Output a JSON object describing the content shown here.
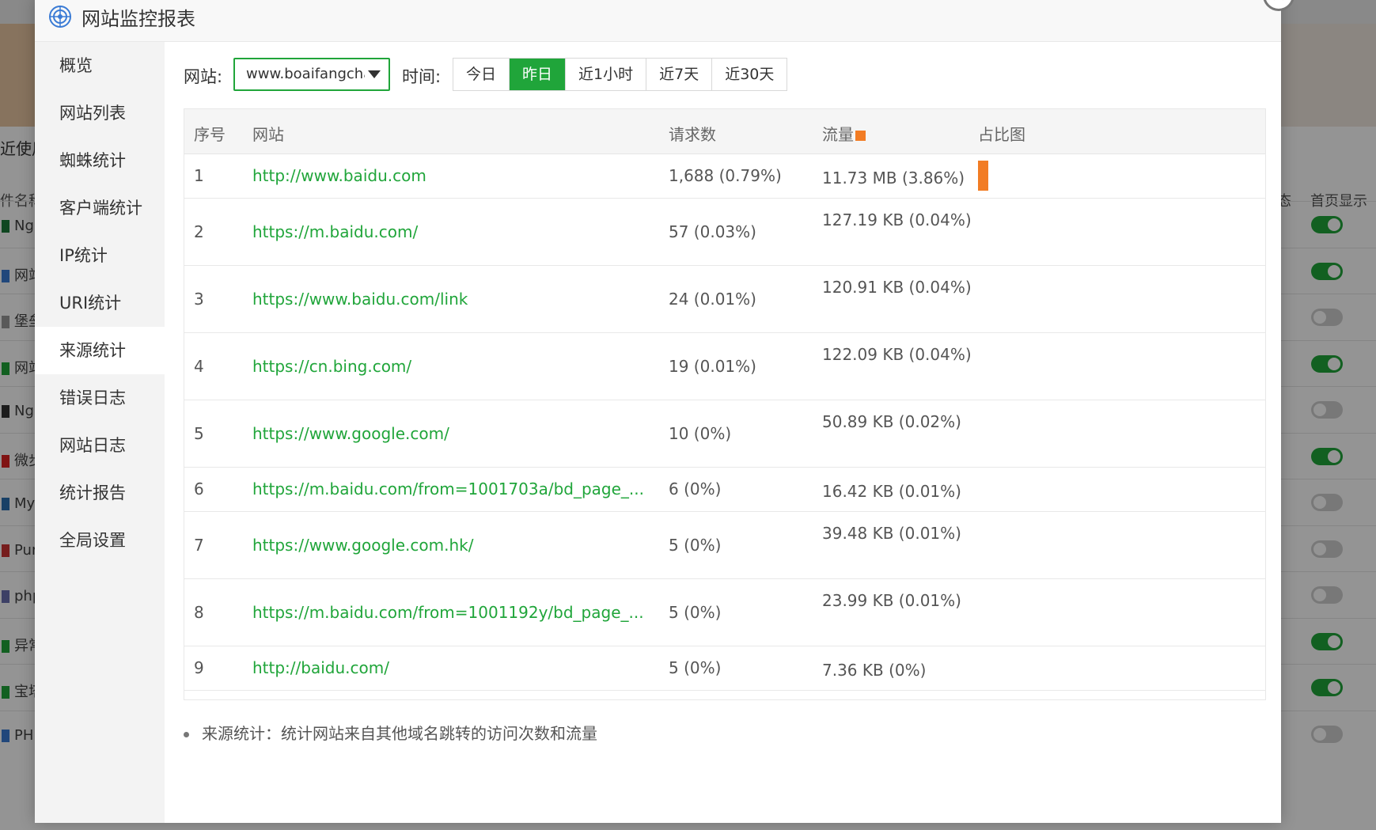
{
  "background": {
    "header_left": "近使用",
    "col_left": "件名称",
    "col_status": "态",
    "col_home": "首页显示",
    "rows": [
      {
        "label": "Ngi",
        "toggle": true
      },
      {
        "label": "网站",
        "toggle": true
      },
      {
        "label": "堡垒",
        "toggle": false
      },
      {
        "label": "网站",
        "toggle": true
      },
      {
        "label": "Ngi",
        "toggle": false
      },
      {
        "label": "微步",
        "toggle": true
      },
      {
        "label": "MyS",
        "toggle": false
      },
      {
        "label": "Pur",
        "toggle": false
      },
      {
        "label": "php",
        "toggle": false
      },
      {
        "label": "异常",
        "toggle": true
      },
      {
        "label": "宝塔",
        "toggle": true
      },
      {
        "label": "PHP",
        "toggle": false
      }
    ]
  },
  "modal": {
    "title": "网站监控报表",
    "close_icon": "close-icon"
  },
  "sidebar": {
    "items": [
      {
        "label": "概览",
        "active": false
      },
      {
        "label": "网站列表",
        "active": false
      },
      {
        "label": "蜘蛛统计",
        "active": false
      },
      {
        "label": "客户端统计",
        "active": false
      },
      {
        "label": "IP统计",
        "active": false
      },
      {
        "label": "URI统计",
        "active": false
      },
      {
        "label": "来源统计",
        "active": true
      },
      {
        "label": "错误日志",
        "active": false
      },
      {
        "label": "网站日志",
        "active": false
      },
      {
        "label": "统计报告",
        "active": false
      },
      {
        "label": "全局设置",
        "active": false
      }
    ]
  },
  "filters": {
    "site_label": "网站:",
    "site_value": "www.boaifangchan.com",
    "time_label": "时间:",
    "time_options": [
      "今日",
      "昨日",
      "近1小时",
      "近7天",
      "近30天"
    ],
    "time_selected": "昨日"
  },
  "table": {
    "headers": {
      "index": "序号",
      "site": "网站",
      "requests": "请求数",
      "traffic": "流量",
      "ratio": "占比图"
    },
    "rows": [
      {
        "index": "1",
        "site": "http://www.baidu.com",
        "requests": "1,688 (0.79%)",
        "traffic": "11.73 MB (3.86%)",
        "ratio": 3.86
      },
      {
        "index": "2",
        "site": "https://m.baidu.com/",
        "requests": "57 (0.03%)",
        "traffic": "127.19 KB (0.04%)",
        "ratio": 0.04
      },
      {
        "index": "3",
        "site": "https://www.baidu.com/link",
        "requests": "24 (0.01%)",
        "traffic": "120.91 KB (0.04%)",
        "ratio": 0.04
      },
      {
        "index": "4",
        "site": "https://cn.bing.com/",
        "requests": "19 (0.01%)",
        "traffic": "122.09 KB (0.04%)",
        "ratio": 0.04
      },
      {
        "index": "5",
        "site": "https://www.google.com/",
        "requests": "10 (0%)",
        "traffic": "50.89 KB (0.02%)",
        "ratio": 0.02
      },
      {
        "index": "6",
        "site": "https://m.baidu.com/from=1001703a/bd_page_...",
        "requests": "6 (0%)",
        "traffic": "16.42 KB (0.01%)",
        "ratio": 0.01
      },
      {
        "index": "7",
        "site": "https://www.google.com.hk/",
        "requests": "5 (0%)",
        "traffic": "39.48 KB (0.01%)",
        "ratio": 0.01
      },
      {
        "index": "8",
        "site": "https://m.baidu.com/from=1001192y/bd_page_...",
        "requests": "5 (0%)",
        "traffic": "23.99 KB (0.01%)",
        "ratio": 0.01
      },
      {
        "index": "9",
        "site": "http://baidu.com/",
        "requests": "5 (0%)",
        "traffic": "7.36 KB (0%)",
        "ratio": 0
      }
    ]
  },
  "note": "来源统计：统计网站来自其他域名跳转的访问次数和流量",
  "colors": {
    "accent": "#20a53a",
    "bar": "#f27c24"
  }
}
